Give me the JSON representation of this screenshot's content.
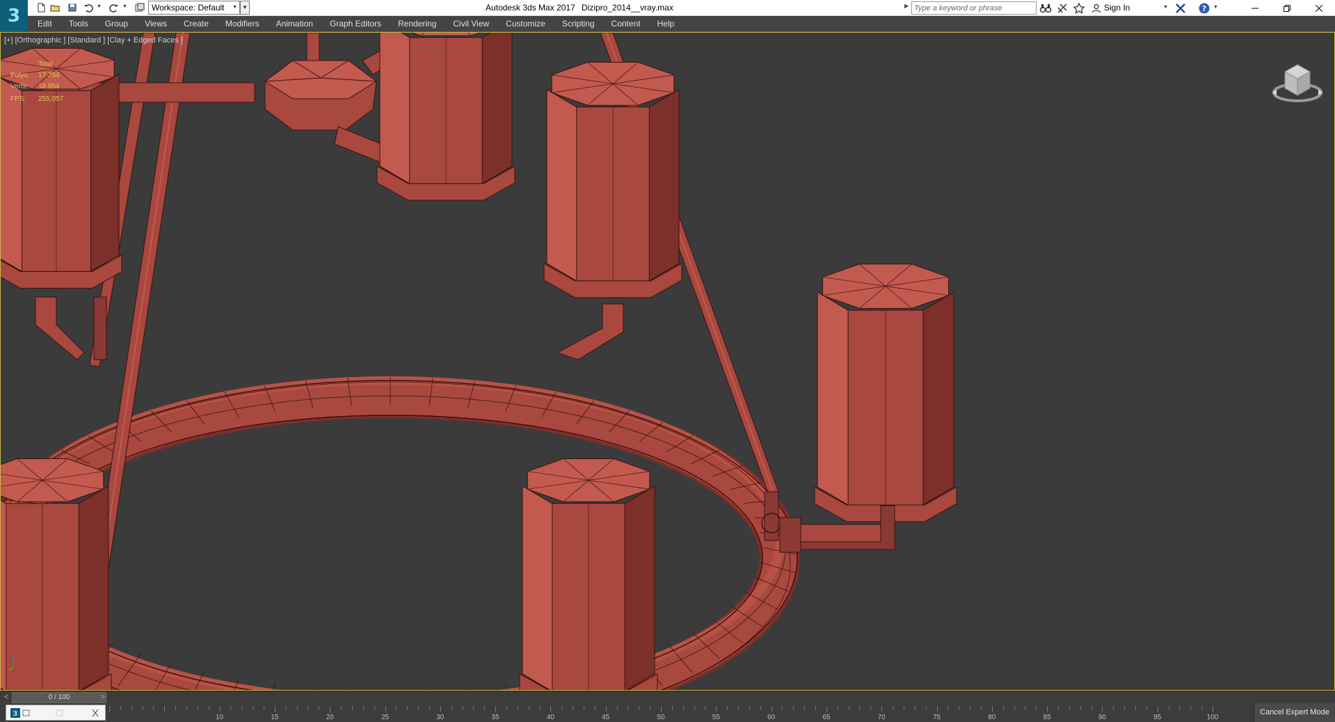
{
  "app": {
    "logo_text": "3",
    "title_app": "Autodesk 3ds Max 2017",
    "title_file": "Dizipro_2014__vray.max"
  },
  "toolbar": {
    "workspace_label": "Workspace: Default",
    "search_placeholder": "Type a keyword or phrase",
    "sign_in": "Sign In"
  },
  "menu": {
    "items": [
      "Edit",
      "Tools",
      "Group",
      "Views",
      "Create",
      "Modifiers",
      "Animation",
      "Graph Editors",
      "Rendering",
      "Civil View",
      "Customize",
      "Scripting",
      "Content",
      "Help"
    ]
  },
  "viewport": {
    "label": "[+] [Orthographic ] [Standard ] [Clay + Edged Faces ]",
    "stats": {
      "total_label": "Total",
      "polys_label": "Polys:",
      "polys_value": "17 754",
      "verts_label": "Verts:",
      "verts_value": "18 854",
      "fps_label": "FPS:",
      "fps_value": "255,057"
    },
    "colors": {
      "background": "#3b3b3b",
      "mesh_fill": "#a8483f",
      "mesh_dark": "#7d2f29",
      "mesh_light": "#c25a4f",
      "edge": "#3a1210",
      "stats_text": "#e3c34f",
      "active_border": "#c9b74a"
    }
  },
  "timeline": {
    "frame_indicator": "0 / 100",
    "ticks": [
      10,
      15,
      20,
      25,
      30,
      35,
      40,
      45,
      50,
      55,
      60,
      65,
      70,
      75,
      80,
      85,
      90,
      95,
      100
    ],
    "expert_mode_button": "Cancel Expert Mode"
  }
}
